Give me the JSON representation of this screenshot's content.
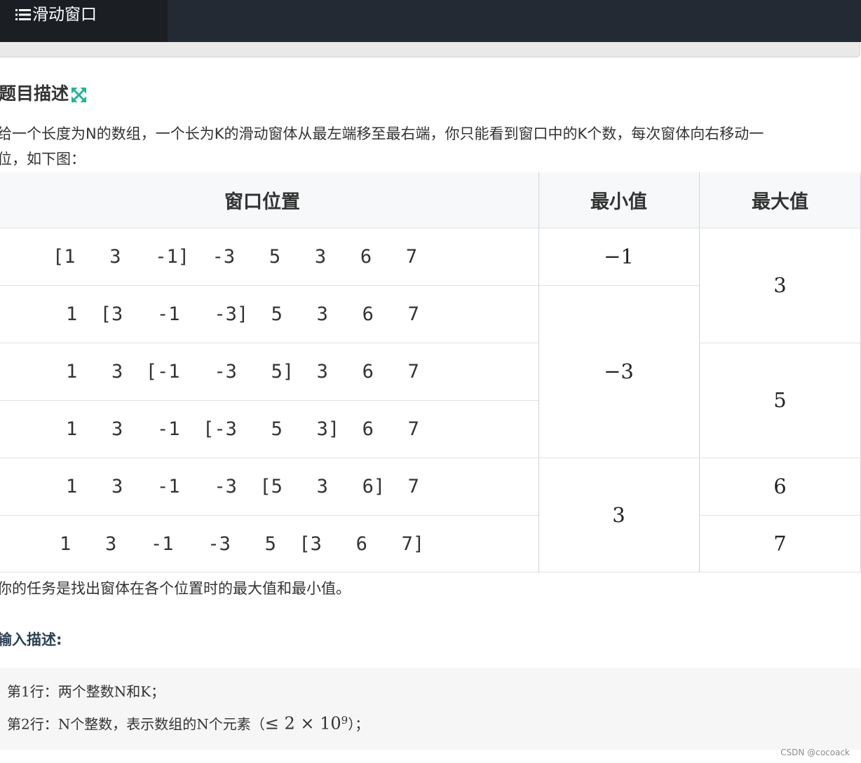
{
  "tab": {
    "label": "滑动窗口",
    "icon": "list-icon"
  },
  "section": {
    "title": "题目描述",
    "icon": "expand-icon"
  },
  "description": {
    "line1": "给一个长度为N的数组，一个长为K的滑动窗体从最左端移至最右端，你只能看到窗口中的K个数，每次窗体向右移动一",
    "line2": "位，如下图："
  },
  "table": {
    "headers": {
      "window": "窗口位置",
      "min": "最小值",
      "max": "最大值"
    },
    "rows": [
      "[1   3   -1]  -3   5   3   6   7",
      "1  [3   -1   -3]  5   3   6   7",
      "1   3  [-1   -3   5]  3   6   7",
      "1   3   -1  [-3   5   3]  6   7",
      "1   3   -1   -3  [5   3   6]  7",
      "1   3   -1   -3   5  [3   6   7]"
    ],
    "min_cells": [
      "−1",
      "−3",
      "3"
    ],
    "max_cells": [
      "3",
      "5",
      "6",
      "7"
    ]
  },
  "task": "你的任务是找出窗体在各个位置时的最大值和最小值。",
  "input": {
    "title": "输入描述:",
    "line1": "第1行：两个整数N和K；",
    "line2_prefix": "第2行：N个整数，表示数组的N个元素（",
    "line2_math": "≤ 2 × 10",
    "line2_exp": "9",
    "line2_suffix": "）；"
  },
  "watermark": "CSDN @cocoack",
  "colors": {
    "topbar": "#242a33",
    "tab_active": "#1b1f24",
    "accent_icon": "#1fb59a",
    "heading_blue": "#2e4155"
  }
}
